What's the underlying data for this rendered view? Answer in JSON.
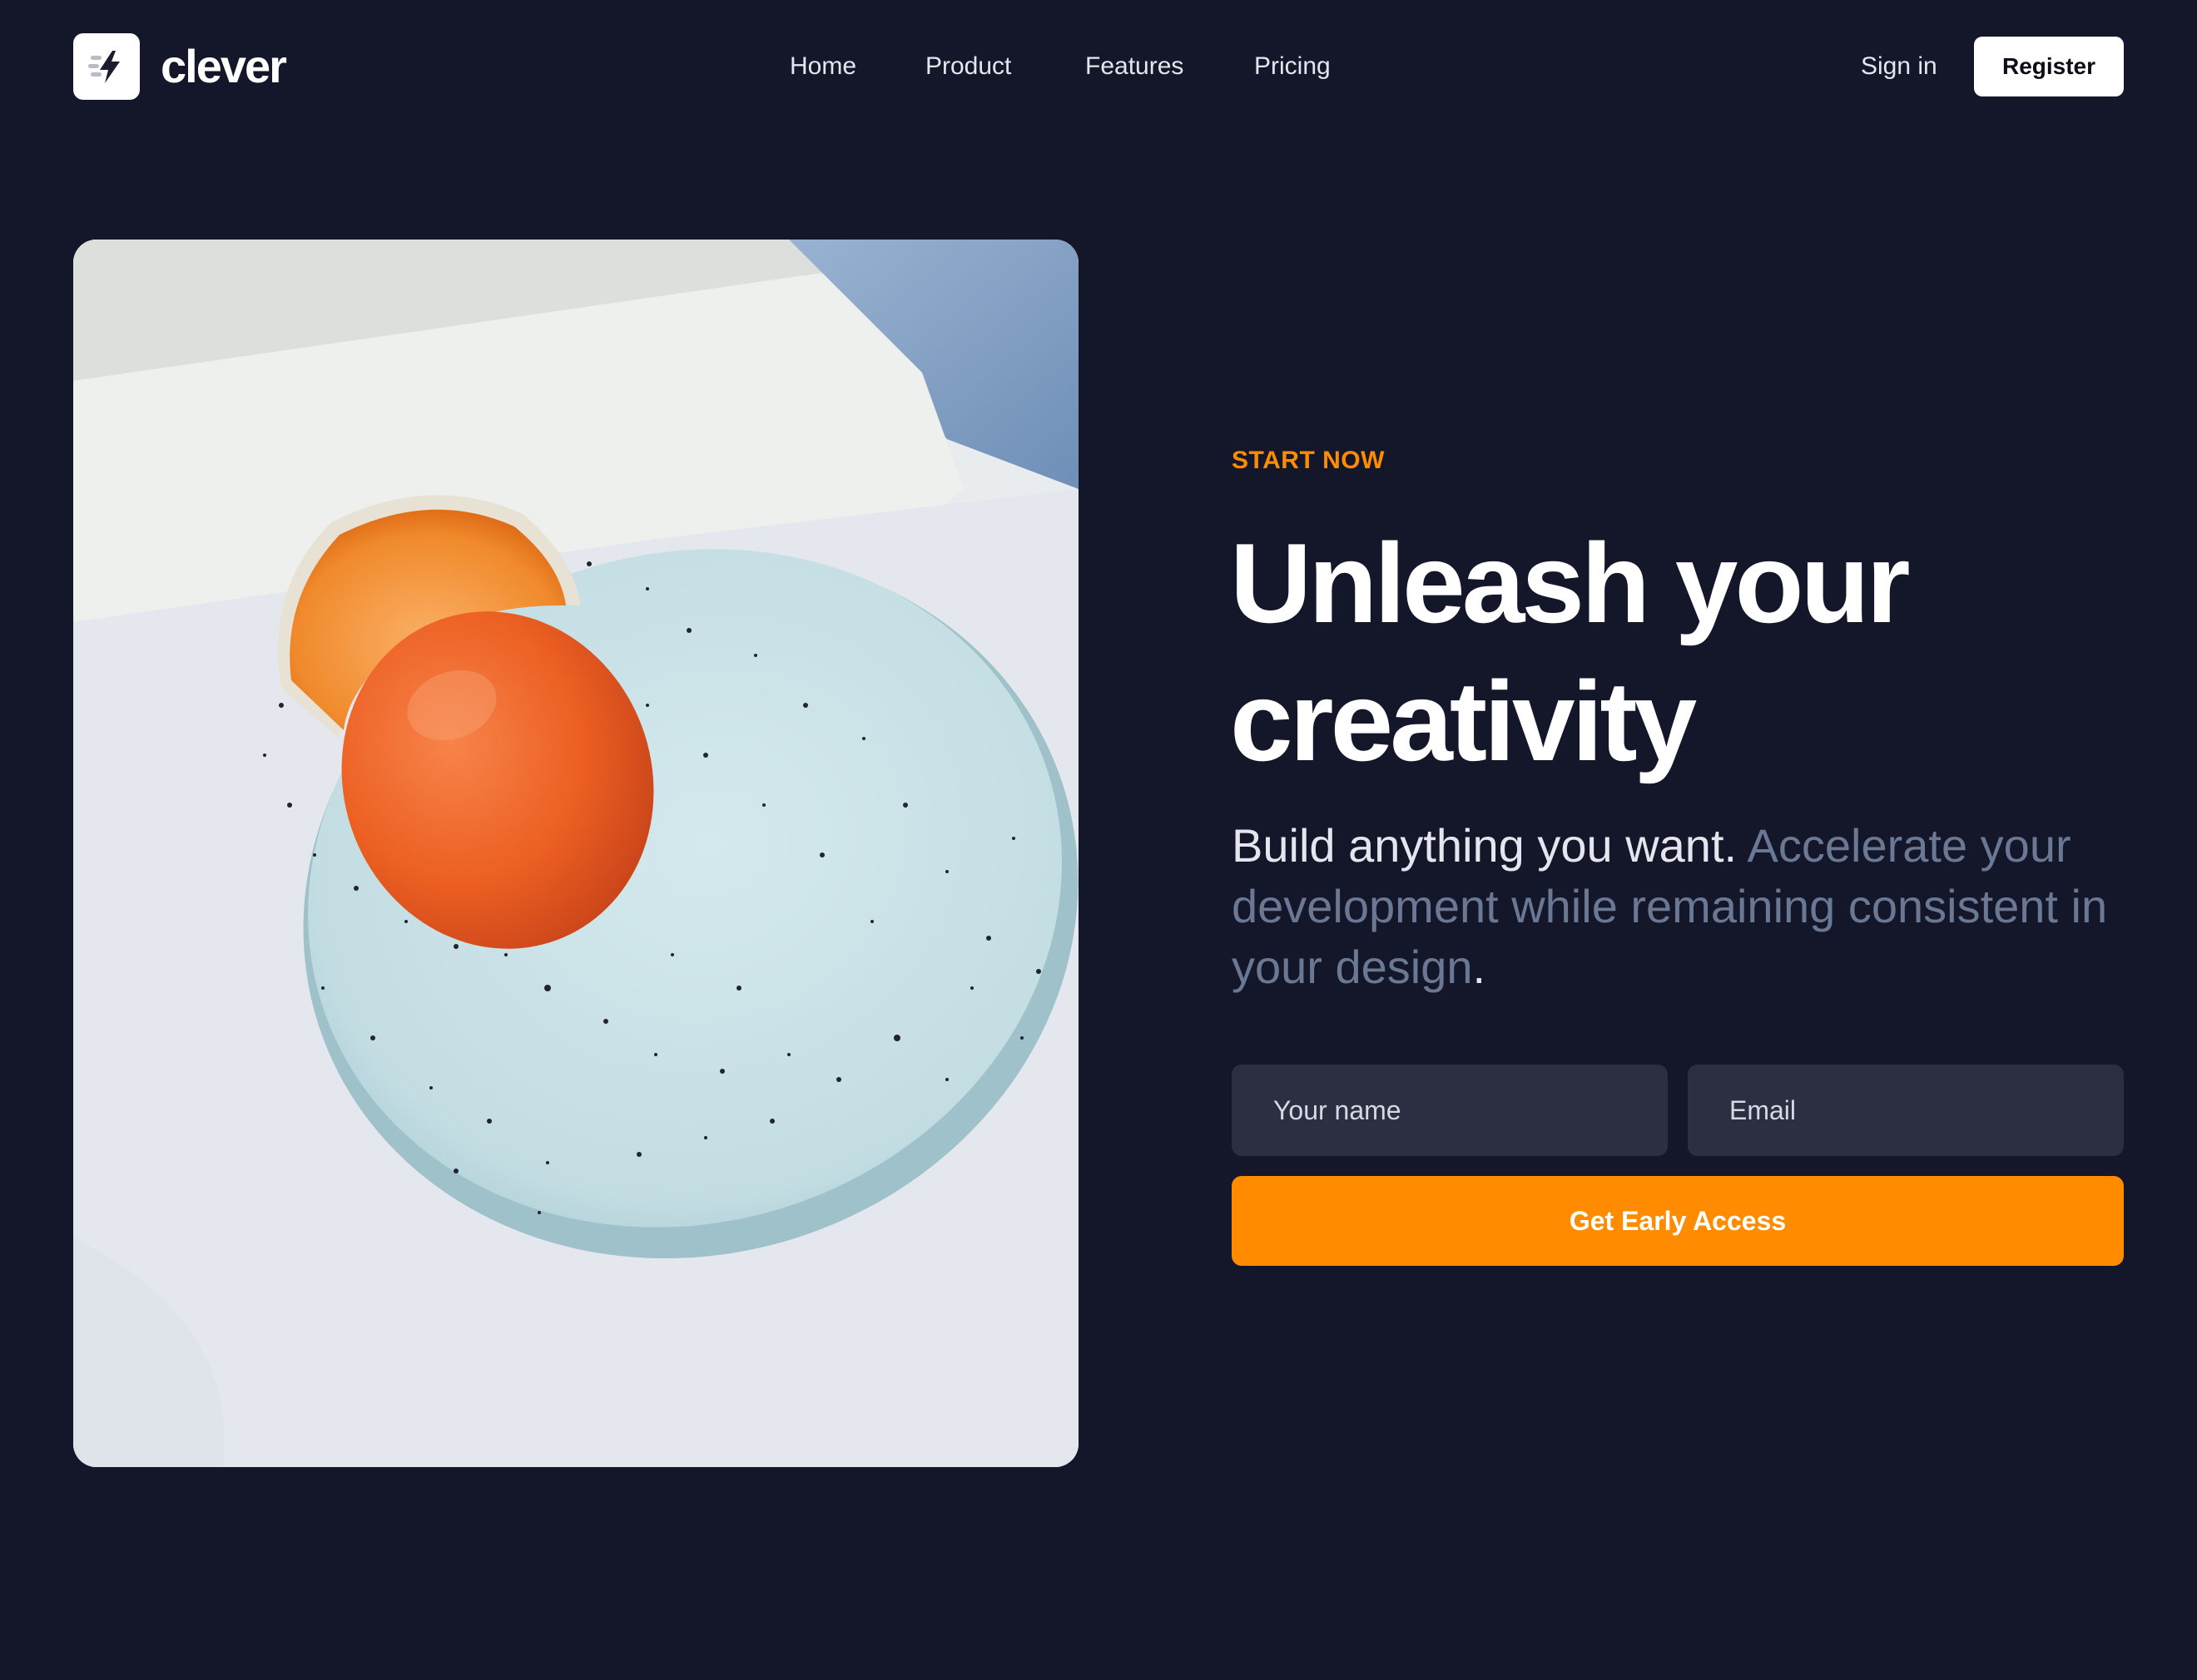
{
  "brand": {
    "name": "clever",
    "logo_icon": "lightning-bolt-icon"
  },
  "nav": {
    "items": [
      {
        "label": "Home"
      },
      {
        "label": "Product"
      },
      {
        "label": "Features"
      },
      {
        "label": "Pricing"
      }
    ]
  },
  "auth": {
    "signin_label": "Sign in",
    "register_label": "Register"
  },
  "hero": {
    "eyebrow": "START NOW",
    "headline_line1": "Unleash your",
    "headline_line2": "creativity",
    "subhead_strong": "Build anything you want.",
    "subhead_muted": " Accelerate your development while remaining consistent in your design",
    "subhead_end": ".",
    "image_label": "hero-photo"
  },
  "form": {
    "name_placeholder": "Your name",
    "name_value": "",
    "email_placeholder": "Email",
    "email_value": "",
    "cta_label": "Get Early Access"
  },
  "colors": {
    "background": "#14172a",
    "accent": "#ff8c00",
    "input_bg": "#2c2f42",
    "muted_text": "#6b7893",
    "primary_text": "#ffffff"
  }
}
